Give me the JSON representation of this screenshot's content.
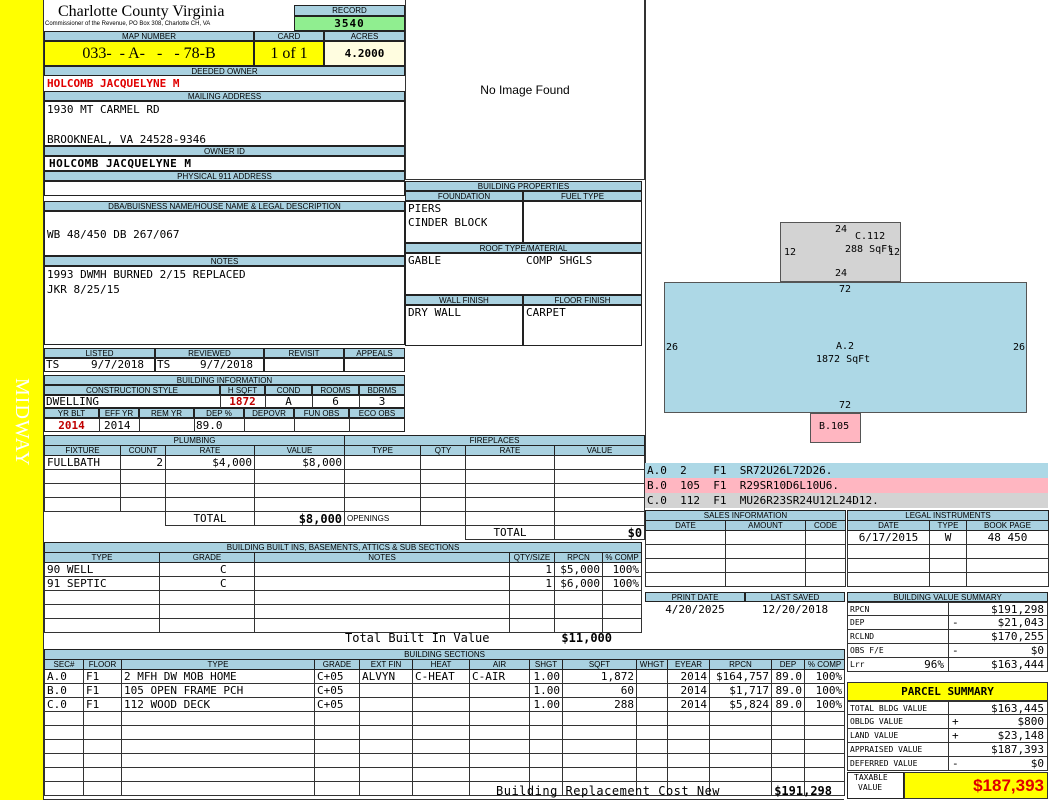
{
  "district": "MIDWAY",
  "county_title": "Charlotte County Virginia",
  "county_subtitle": "Commissioner of the Revenue, PO Box 308, Charlotte CH, VA",
  "record": {
    "label": "RECORD",
    "value": "3540"
  },
  "map_number": {
    "label": "MAP NUMBER",
    "value": "033-  - A-   -   - 78-B"
  },
  "card": {
    "label": "CARD",
    "value": "1 of 1"
  },
  "acres": {
    "label": "ACRES",
    "value": "4.2000"
  },
  "deeded_owner": {
    "label": "DEEDED OWNER",
    "value": "HOLCOMB JACQUELYNE M"
  },
  "mailing_address": {
    "label": "MAILING ADDRESS",
    "line1": "1930 MT CARMEL RD",
    "line2": "BROOKNEAL, VA 24528-9346"
  },
  "owner_id": {
    "label": "OWNER ID",
    "value": "HOLCOMB JACQUELYNE M"
  },
  "physical_address": {
    "label": "PHYSICAL 911 ADDRESS",
    "value": ""
  },
  "legal": {
    "label": "DBA/BUISNESS NAME/HOUSE NAME & LEGAL DESCRIPTION",
    "value": "WB 48/450 DB 267/067"
  },
  "notes": {
    "label": "NOTES",
    "line1": "1993 DWMH BURNED 2/15 REPLACED",
    "line2": "JKR 8/25/15"
  },
  "photo": {
    "text": "No Image Found"
  },
  "building_properties": {
    "title": "BUILDING PROPERTIES",
    "foundation_label": "FOUNDATION",
    "foundation_1": "PIERS",
    "foundation_2": "CINDER BLOCK",
    "fuel_label": "FUEL TYPE",
    "fuel": "",
    "roof_label": "ROOF TYPE/MATERIAL",
    "roof_type": "GABLE",
    "roof_material": "COMP SHGLS",
    "wall_label": "WALL FINISH",
    "wall": "DRY WALL",
    "floor_label": "FLOOR FINISH",
    "floor": "CARPET"
  },
  "review": {
    "listed_label": "LISTED",
    "listed_by": "TS",
    "listed_date": "9/7/2018",
    "reviewed_label": "REVIEWED",
    "reviewed_by": "TS",
    "reviewed_date": "9/7/2018",
    "revisit_label": "REVISIT",
    "appeals_label": "APPEALS"
  },
  "building_info": {
    "title": "BUILDING INFORMATION",
    "style_label": "CONSTRUCTION STYLE",
    "style": "DWELLING",
    "hsqft_label": "H SQFT",
    "hsqft": "1872",
    "cond_label": "COND",
    "cond": "A",
    "rooms_label": "ROOMS",
    "rooms": "6",
    "bdrms_label": "BDRMS",
    "bdrms": "3",
    "yrblt_label": "YR BLT",
    "yrblt": "2014",
    "effyr_label": "EFF YR",
    "effyr": "2014",
    "remyr_label": "REM YR",
    "remyr": "",
    "dep_label": "DEP %",
    "dep": "89.0",
    "depovr_label": "DEPOVR",
    "funobs_label": "FUN OBS",
    "ecoobs_label": "ECO OBS"
  },
  "plumbing": {
    "title": "PLUMBING",
    "columns": [
      "FIXTURE",
      "COUNT",
      "RATE",
      "VALUE"
    ],
    "rows": [
      [
        "FULLBATH",
        "2",
        "$4,000",
        "$8,000"
      ]
    ],
    "total_label": "TOTAL",
    "total": "$8,000"
  },
  "fireplaces": {
    "title": "FIREPLACES",
    "columns": [
      "TYPE",
      "QTY",
      "RATE",
      "VALUE"
    ],
    "openings_label": "OPENINGS",
    "total_label": "TOTAL",
    "total": "$0"
  },
  "built_ins": {
    "title": "BUILDING BUILT INS, BASEMENTS, ATTICS & SUB SECTIONS",
    "columns": [
      "TYPE",
      "GRADE",
      "NOTES",
      "QTY/SIZE",
      "RPCN",
      "% COMP"
    ],
    "rows": [
      [
        "90 WELL",
        "C",
        "",
        "1",
        "$5,000",
        "100%"
      ],
      [
        "91 SEPTIC",
        "C",
        "",
        "1",
        "$6,000",
        "100%"
      ]
    ],
    "total_label": "Total Built In Value",
    "total": "$11,000"
  },
  "sketch": {
    "c_label": "C.112",
    "c_sqft": "288 SqFt",
    "c_top": "24",
    "c_bottom": "24",
    "c_left": "12",
    "c_right": "12",
    "a_label": "A.2",
    "a_sqft": "1872 SqFt",
    "a_top": "72",
    "a_bottom": "72",
    "a_left": "26",
    "a_right": "26",
    "b_label": "B.105",
    "legend": [
      "A.0  2    F1  SR72U26L72D26.",
      "B.0  105  F1  R29SR10D6L10U6.",
      "C.0  112  F1  MU26R23SR24U12L24D12."
    ],
    "colors": {
      "a": "#add8e6",
      "b": "#ffb6c1",
      "c": "#d3d3d3"
    }
  },
  "sales": {
    "title": "SALES INFORMATION",
    "columns": [
      "DATE",
      "AMOUNT",
      "CODE"
    ]
  },
  "legal_instruments": {
    "title": "LEGAL INSTRUMENTS",
    "columns": [
      "DATE",
      "TYPE",
      "BOOK PAGE"
    ],
    "rows": [
      [
        "6/17/2015",
        "W",
        "48 450"
      ]
    ]
  },
  "print_info": {
    "print_label": "PRINT DATE",
    "print_date": "4/20/2025",
    "saved_label": "LAST SAVED",
    "saved_date": "12/20/2018"
  },
  "building_value_summary": {
    "title": "BUILDING VALUE SUMMARY",
    "rows": [
      {
        "label": "RPCN",
        "sign": "",
        "value": "$191,298"
      },
      {
        "label": "DEP",
        "sign": "-",
        "value": "$21,043"
      },
      {
        "label": "RCLND",
        "sign": "",
        "value": "$170,255"
      },
      {
        "label": "OBS F/E",
        "sign": "-",
        "value": "$0"
      },
      {
        "label": "Lrr",
        "pct": "96%",
        "sign": "",
        "value": "$163,444"
      }
    ]
  },
  "parcel_summary": {
    "title": "PARCEL SUMMARY",
    "rows": [
      {
        "label": "TOTAL BLDG VALUE",
        "sign": "",
        "value": "$163,445"
      },
      {
        "label": "OBLDG VALUE",
        "sign": "+",
        "value": "$800"
      },
      {
        "label": "LAND VALUE",
        "sign": "+",
        "value": "$23,148"
      },
      {
        "label": "APPRAISED VALUE",
        "sign": "",
        "value": "$187,393"
      },
      {
        "label": "DEFERRED VALUE",
        "sign": "-",
        "value": "$0"
      }
    ],
    "taxable_label_1": "TAXABLE",
    "taxable_label_2": "VALUE",
    "taxable_value": "$187,393"
  },
  "building_sections": {
    "title": "BUILDING SECTIONS",
    "columns": [
      "SEC#",
      "FLOOR",
      "TYPE",
      "GRADE",
      "EXT FIN",
      "HEAT",
      "AIR",
      "SHGT",
      "SQFT",
      "WHGT",
      "EYEAR",
      "RPCN",
      "DEP",
      "% COMP"
    ],
    "rows": [
      [
        "A.0",
        "F1",
        "2 MFH DW MOB HOME",
        "C+05",
        "ALVYN",
        "C-HEAT",
        "C-AIR",
        "1.00",
        "1,872",
        "",
        "2014",
        "$164,757",
        "89.0",
        "100%"
      ],
      [
        "B.0",
        "F1",
        "105 OPEN FRAME PCH",
        "C+05",
        "",
        "",
        "",
        "1.00",
        "60",
        "",
        "2014",
        "$1,717",
        "89.0",
        "100%"
      ],
      [
        "C.0",
        "F1",
        "112 WOOD DECK",
        "C+05",
        "",
        "",
        "",
        "1.00",
        "288",
        "",
        "2014",
        "$5,824",
        "89.0",
        "100%"
      ]
    ],
    "total_label": "Building Replacement Cost New",
    "total": "$191,298"
  }
}
